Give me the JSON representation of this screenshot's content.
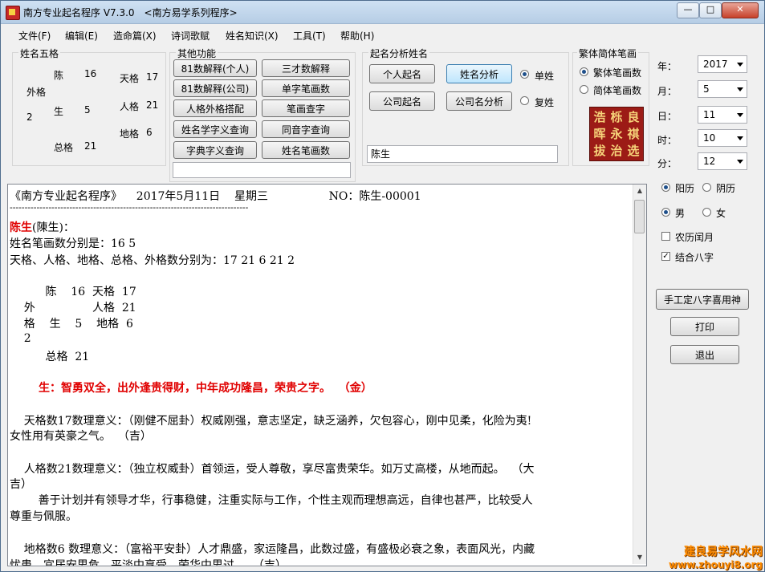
{
  "window": {
    "title": "南方专业起名程序 V7.3.0　<南方易学系列程序>"
  },
  "menu": [
    "文件(F)",
    "编辑(E)",
    "造命篇(X)",
    "诗词歌赋",
    "姓名知识(X)",
    "工具(T)",
    "帮助(H)"
  ],
  "wuge": {
    "title": "姓名五格",
    "chen": "陈",
    "chen_n": "16",
    "tiange": "天格",
    "tiange_n": "17",
    "wai": "外格",
    "sheng": "生",
    "sheng_n": "5",
    "renge": "人格",
    "renge_n": "21",
    "wai_n": "2",
    "dige": "地格",
    "dige_n": "6",
    "zongge": "总格",
    "zongge_n": "21"
  },
  "other": {
    "title": "其他功能",
    "buttons": [
      "81数解释(个人)",
      "三才数解释",
      "81数解释(公司)",
      "单字笔画数",
      "人格外格搭配",
      "笔画查字",
      "姓名学字义查询",
      "同音字查询",
      "字典字义查询",
      "姓名笔画数"
    ],
    "input": ""
  },
  "analysis": {
    "title": "起名分析姓名",
    "btn_personal": "个人起名",
    "btn_analyze": "姓名分析",
    "btn_company": "公司起名",
    "btn_company_analyze": "公司名分析",
    "radio_single": "单姓",
    "radio_double": "复姓",
    "name_value": "陈生"
  },
  "trad": {
    "title": "繁体简体笔画",
    "opt_trad": "繁体笔画数",
    "opt_simp": "简体笔画数",
    "chars": [
      "浩",
      "栎",
      "良",
      "晖",
      "永",
      "祺",
      "拔",
      "治",
      "选"
    ]
  },
  "date": {
    "year_label": "年：",
    "year": "2017",
    "month_label": "月：",
    "month": "5",
    "day_label": "日：",
    "day": "11",
    "hour_label": "时：",
    "hour": "10",
    "min_label": "分：",
    "min": "12"
  },
  "options": {
    "solar": "阳历",
    "lunar": "阴历",
    "male": "男",
    "female": "女",
    "leap": "农历闰月",
    "bazi": "结合八字",
    "btn_bazi": "手工定八字喜用神",
    "btn_print": "打印",
    "btn_exit": "退出"
  },
  "content": {
    "l1": "《南方专业起名程序》    2017年5月11日    星期三                 NO：陈生-00001",
    "dash": "--------------------------------------------------------------------------------",
    "name": "陈生",
    "name_trad": "(陳生)：",
    "l3": "姓名笔画数分别是：16 5",
    "l4": "天格、人格、地格、总格、外格数分别为：17 21 6 21 2",
    "g1": "          陈    16  天格  17",
    "g2": "    外                人格  21",
    "g3": "    格    生    5    地格  6",
    "g4": "    2",
    "g5": "          总格  21",
    "red_line": "生：智勇双全，出外逢贵得财，中年成功隆昌，荣贵之字。  （金）",
    "p1a": "    天格数17数理意义：（刚健不屈卦）权威刚强，意志坚定，缺乏涵养，欠包容心，刚中见柔，化险为夷!",
    "p1b": "女性用有英豪之气。  （吉）",
    "p2a": "    人格数21数理意义：（独立权威卦）首领运，受人尊敬，享尽富贵荣华。如万丈高楼，从地而起。  （大",
    "p2b": "吉）",
    "p3a": "        善于计划并有领导才华，行事稳健，注重实际与工作，个性主观而理想高远，自律也甚严，比较受人",
    "p3b": "尊重与佩服。",
    "p4a": "    地格数6 数理意义：（富裕平安卦）人才鼎盛，家运隆昌，此数过盛，有盛极必衰之象，表面风光，内藏",
    "p4b": "忧患，宜居安思危，平淡中享受，荣华中思过。  （吉）"
  },
  "watermark": {
    "l1": "建良易学风水网",
    "l2": "www.zhouyi8.org"
  },
  "colors": {
    "red": "#e00000",
    "accent": "#3c7fb1",
    "calligraphy_bg": "#9c1b16"
  }
}
